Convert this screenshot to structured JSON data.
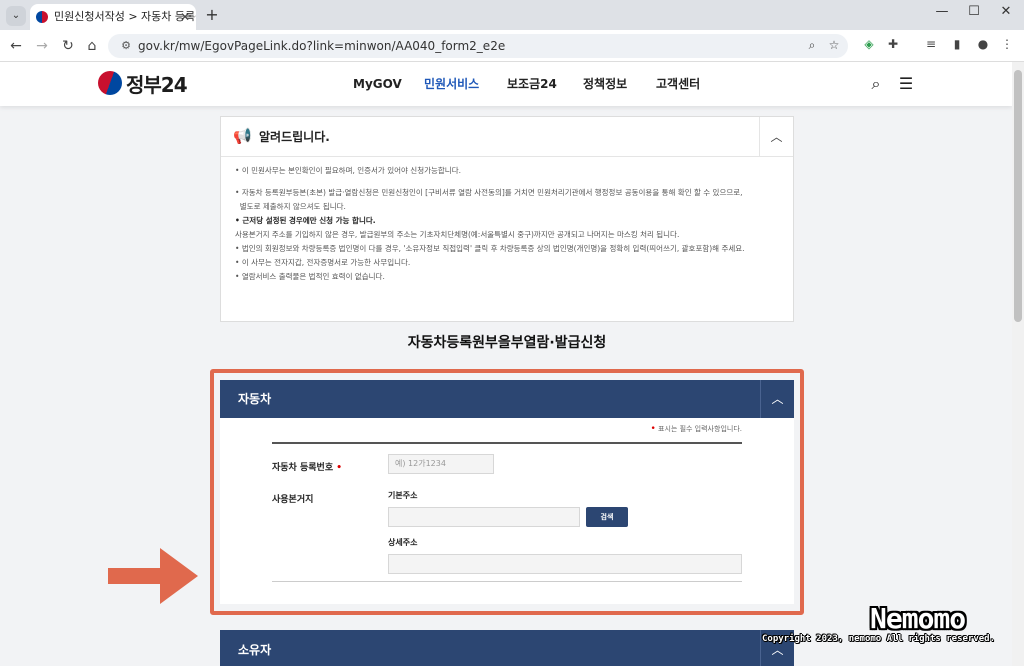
{
  "browser": {
    "tab_title": "민원신청서작성 > 자동차 등록원부",
    "url": "gov.kr/mw/EgovPageLink.do?link=minwon/AA040_form2_e2e"
  },
  "site": {
    "logo": "정부24",
    "nav": [
      "MyGOV",
      "민원서비스",
      "보조금24",
      "정책정보",
      "고객센터"
    ]
  },
  "notice": {
    "title": "알려드립니다.",
    "lines": [
      "이 민원사무는 본인확인이 필요하며, 인증서가 있어야 신청가능합니다.",
      "자동차 등록원부등본(초본) 발급·열람신청은 민원신청인이 [구비서류 열람 사전동의]를 거치면 민원처리기관에서 행정정보 공동이용을 통해 확인 할 수 있으므로,",
      "별도로 제출하지 않으셔도 됩니다.",
      "근저당 설정된 경우에만 신청 가능 합니다.",
      "사용본거지 주소를 기입하지 않은 경우, 발급원부의 주소는 기초자치단체명(예:서울특별시 중구)까지만 공개되고 나머지는 마스킹 처리 됩니다.",
      "법인의 회원정보와 차량등록증 법인명이 다를 경우, '소유자정보 직접입력' 클릭 후 차량등록증 상의 법인명(개인명)을 정확히 입력(띄어쓰기, 괄호포함)해 주세요.",
      "이 사무는 전자지갑, 전자증명서로 가능한 사무입니다.",
      "열람서비스 출력물은 법적인 효력이 없습니다."
    ]
  },
  "page_title": "자동차등록원부을부열람·발급신청",
  "section_car": {
    "title": "자동차",
    "required_note": "표시는 필수 입력사항입니다.",
    "reg_label": "자동차 등록번호",
    "reg_placeholder": "예) 12가1234",
    "addr_label": "사용본거지",
    "basic_addr_label": "기본주소",
    "search_btn": "검색",
    "detail_addr_label": "상세주소"
  },
  "section_owner": {
    "title": "소유자"
  },
  "watermark": {
    "brand": "Nemomo",
    "copyright": "Copyright 2023, nemomo All rights reserved."
  },
  "colors": {
    "section_bar": "#2c4672",
    "highlight": "#e0694d",
    "nav_active": "#1f58b8"
  }
}
